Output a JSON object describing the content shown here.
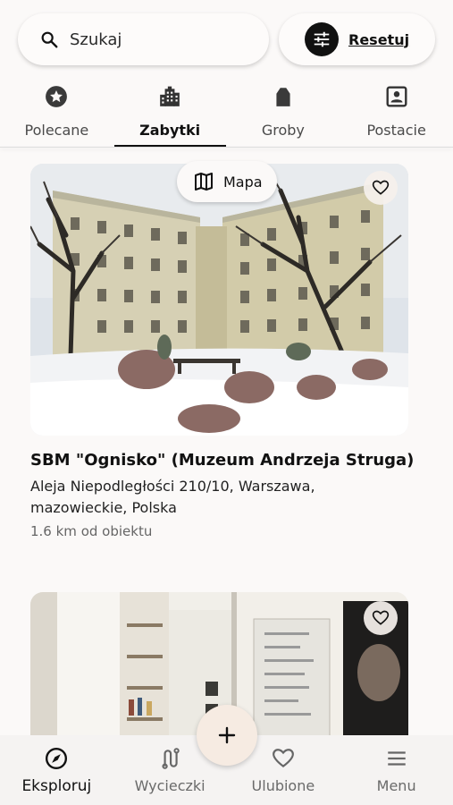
{
  "search": {
    "placeholder": "Szukaj"
  },
  "reset": {
    "label": "Resetuj"
  },
  "categories": [
    {
      "label": "Polecane",
      "icon": "star-badge-icon"
    },
    {
      "label": "Zabytki",
      "icon": "building-icon",
      "active": true
    },
    {
      "label": "Groby",
      "icon": "tombstone-icon"
    },
    {
      "label": "Postacie",
      "icon": "person-portrait-icon"
    }
  ],
  "map_chip": {
    "label": "Mapa"
  },
  "cards": [
    {
      "title": "SBM \"Ognisko\" (Muzeum Andrzeja Struga)",
      "address": "Aleja Niepodległości 210/10, Warszawa, mazowieckie, Polska",
      "distance": "1.6 km od obiektu"
    }
  ],
  "bottom_nav": [
    {
      "label": "Eksploruj",
      "icon": "compass-icon",
      "active": true
    },
    {
      "label": "Wycieczki",
      "icon": "route-icon"
    },
    {
      "label": "Ulubione",
      "icon": "heart-icon"
    },
    {
      "label": "Menu",
      "icon": "hamburger-menu-icon"
    }
  ],
  "fab": {
    "icon": "plus-icon"
  }
}
